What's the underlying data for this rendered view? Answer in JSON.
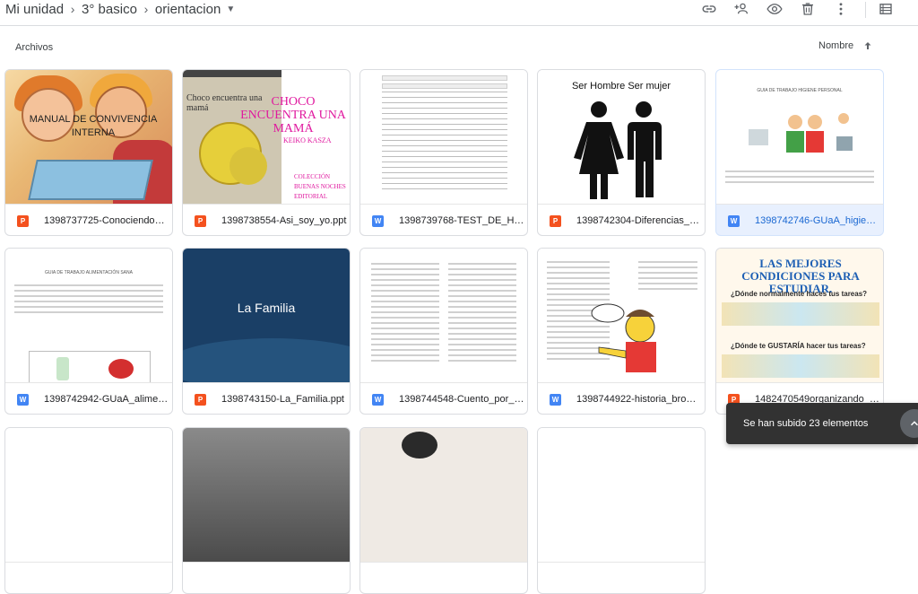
{
  "breadcrumb": {
    "items": [
      "Mi unidad",
      "3° basico",
      "orientacion"
    ],
    "separator": ">"
  },
  "toolbar": {
    "icons": [
      "link-icon",
      "add-person-icon",
      "preview-eye-icon",
      "trash-icon",
      "more-vert-icon",
      "list-view-icon"
    ]
  },
  "section": {
    "title": "Archivos",
    "sort_label": "Nombre"
  },
  "files": [
    {
      "name": "1398737725-Conociendo_n...",
      "type": "ppt",
      "thumb_title": "MANUAL DE CONVIVENCIA INTERNA"
    },
    {
      "name": "1398738554-Asi_soy_yo.ppt",
      "type": "ppt",
      "thumb_title": "CHOCO ENCUENTRA UNA MAMÁ",
      "thumb_author": "KEIKO KASZA",
      "thumb_collection": "COLECCIÓN BUENAS NOCHES EDITORIAL NORMA",
      "thumb_cover": "Choco encuentra una mamá"
    },
    {
      "name": "1398739768-TEST_DE_HaB...",
      "type": "doc"
    },
    {
      "name": "1398742304-Diferencias_H...",
      "type": "ppt",
      "thumb_title": "Ser Hombre Ser mujer"
    },
    {
      "name": "1398742746-GUaA_higiene...",
      "type": "doc",
      "selected": true,
      "thumb_title": "GUIA DE TRABAJO HIGIENE PERSONAL"
    },
    {
      "name": "1398742942-GUaA_aliment...",
      "type": "doc",
      "thumb_title": "GUIA DE TRABAJO ALIMENTACIÓN SANA"
    },
    {
      "name": "1398743150-La_Familia.ppt",
      "type": "ppt",
      "thumb_title": "La Familia"
    },
    {
      "name": "1398744548-Cuento_por_fa...",
      "type": "doc"
    },
    {
      "name": "1398744922-historia_bromi...",
      "type": "doc"
    },
    {
      "name": "1482470549organizando_m...",
      "type": "ppt",
      "thumb_title": "LAS MEJORES CONDICIONES PARA ESTUDIAR.",
      "thumb_q1": "¿Dónde normalmente haces tus tareas?",
      "thumb_q2": "¿Dónde te GUSTARÍA hacer tus tareas?"
    }
  ],
  "type_badges": {
    "ppt": "P",
    "doc": "W"
  },
  "toast": {
    "message": "Se han subido 23 elementos"
  },
  "colors": {
    "ppt": "#f4511e",
    "doc": "#4285f4",
    "selected": "#e8f0fe"
  }
}
